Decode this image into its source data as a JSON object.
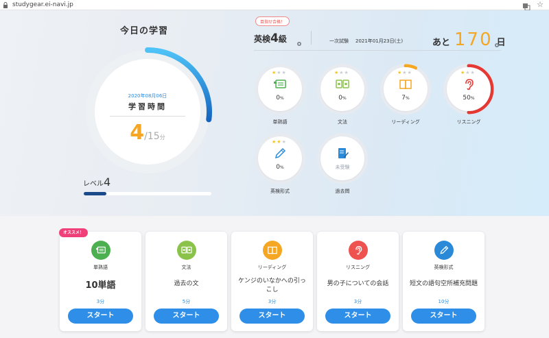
{
  "browser": {
    "url": "studygear.ei-navi.jp"
  },
  "today": {
    "title": "今日の学習",
    "date": "2020年08月06日",
    "label": "学習時間",
    "minutes_done": "4",
    "minutes_goal": "15",
    "unit": "分",
    "progress_fraction": 0.27
  },
  "level": {
    "label": "レベル",
    "value": "4",
    "progress_fraction": 0.18
  },
  "exam": {
    "badge": "目指せ合格！",
    "name": "英検",
    "grade": "4",
    "grade_suffix": "級",
    "type": "一次試験",
    "date": "2021年01月23日(土)",
    "countdown_prefix": "あと",
    "countdown_days": "170",
    "countdown_suffix": "日"
  },
  "skills": [
    {
      "label": "単熟語",
      "value": "0",
      "unit": "%",
      "stars_on": 1,
      "fraction": 0,
      "color": "#4caf50",
      "icon": "vocab-card-icon"
    },
    {
      "label": "文法",
      "value": "0",
      "unit": "%",
      "stars_on": 1,
      "fraction": 0,
      "color": "#8bc34a",
      "icon": "grammar-cards-icon"
    },
    {
      "label": "リーディング",
      "value": "7",
      "unit": "%",
      "stars_on": 1,
      "fraction": 0.07,
      "color": "#f5a623",
      "icon": "book-icon"
    },
    {
      "label": "リスニング",
      "value": "50",
      "unit": "%",
      "stars_on": 1,
      "fraction": 0.5,
      "color": "#e53935",
      "icon": "ear-icon"
    },
    {
      "label": "英検形式",
      "value": "0",
      "unit": "%",
      "stars_on": 2,
      "fraction": 0,
      "color": "#2a8ad8",
      "icon": "pencil-icon"
    },
    {
      "label": "過去問",
      "pending": "未受験",
      "icon": "document-edit-icon",
      "color": "#2a8ad8"
    }
  ],
  "cards": [
    {
      "category": "単熟語",
      "title": "10単語",
      "minutes": "3分",
      "button": "スタート",
      "color": "#4caf50"
    },
    {
      "category": "文法",
      "title": "過去の文",
      "minutes": "5分",
      "button": "スタート",
      "color": "#8bc34a"
    },
    {
      "category": "リーディング",
      "title": "ケンジのいなかへの引っこし",
      "minutes": "3分",
      "button": "スタート",
      "color": "#f5a623"
    },
    {
      "category": "リスニング",
      "title": "男の子についての会話",
      "minutes": "3分",
      "button": "スタート",
      "color": "#ef5350"
    },
    {
      "category": "英検形式",
      "title": "短文の語句空所補充問題",
      "minutes": "10分",
      "button": "スタート",
      "color": "#2a8ad8"
    }
  ],
  "recommend_badge": "オススメ！"
}
